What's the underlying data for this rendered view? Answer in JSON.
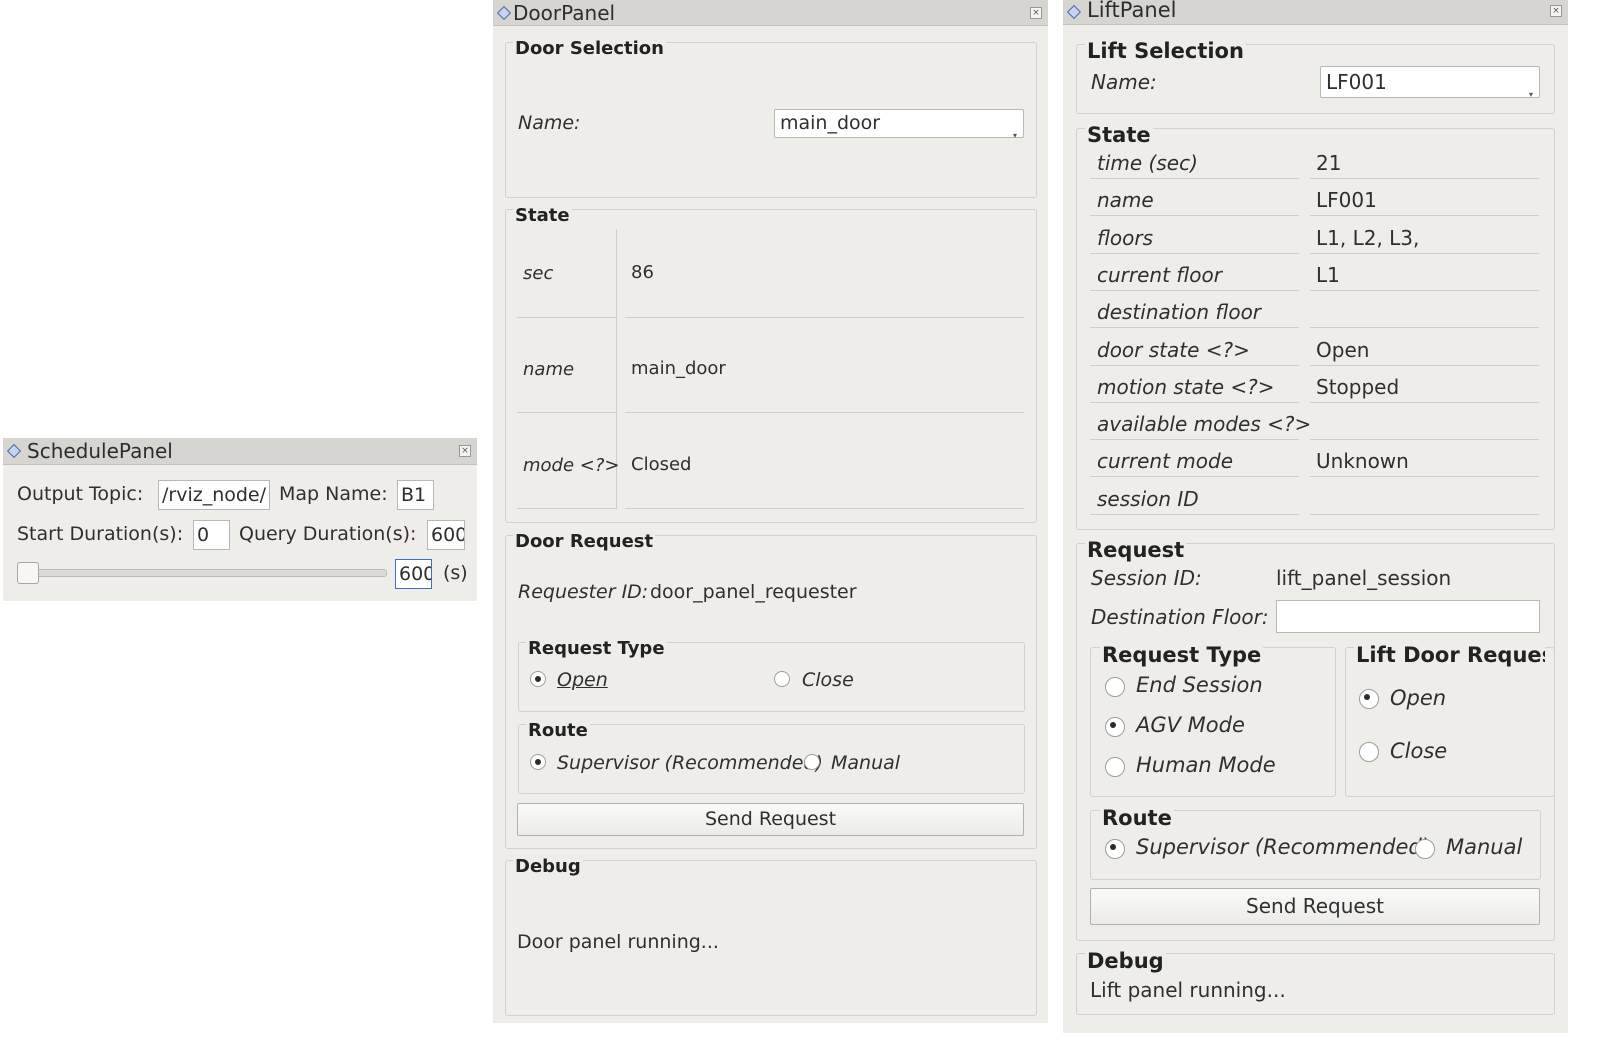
{
  "schedule": {
    "title": "SchedulePanel",
    "output_topic_label": "Output Topic:",
    "output_topic_value": "/rviz_node/",
    "map_name_label": "Map Name:",
    "map_name_value": "B1",
    "start_duration_label": "Start Duration(s):",
    "start_duration_value": "0",
    "query_duration_label": "Query Duration(s):",
    "query_duration_value": "600",
    "slider_value": "600",
    "slider_fraction": 0.0,
    "unit_label": "(s)"
  },
  "door": {
    "title": "DoorPanel",
    "selection_group": "Door Selection",
    "name_label": "Name:",
    "name_value": "main_door",
    "state_group": "State",
    "state_rows": [
      {
        "key": "sec",
        "value": "86"
      },
      {
        "key": "name",
        "value": "main_door"
      },
      {
        "key": "mode <?>",
        "value": "Closed"
      }
    ],
    "request_group": "Door Request",
    "requester_label": "Requester ID:",
    "requester_value": "door_panel_requester",
    "request_type_group": "Request Type",
    "request_type_options": [
      {
        "label": "Open",
        "selected": true
      },
      {
        "label": "Close",
        "selected": false
      }
    ],
    "route_group": "Route",
    "route_options": [
      {
        "label": "Supervisor (Recommended)",
        "selected": true
      },
      {
        "label": "Manual",
        "selected": false
      }
    ],
    "send_button": "Send Request",
    "debug_group": "Debug",
    "debug_text": "Door panel running..."
  },
  "lift": {
    "title": "LiftPanel",
    "selection_group": "Lift Selection",
    "name_label": "Name:",
    "name_value": "LF001",
    "state_group": "State",
    "state_rows": [
      {
        "key": "time (sec)",
        "value": "21"
      },
      {
        "key": "name",
        "value": "LF001"
      },
      {
        "key": "floors",
        "value": "L1, L2, L3,"
      },
      {
        "key": "current floor",
        "value": "L1"
      },
      {
        "key": "destination floor",
        "value": ""
      },
      {
        "key": "door state <?>",
        "value": "Open"
      },
      {
        "key": "motion state <?>",
        "value": "Stopped"
      },
      {
        "key": "available modes <?>",
        "value": ""
      },
      {
        "key": "current mode",
        "value": "Unknown"
      },
      {
        "key": "session ID",
        "value": ""
      }
    ],
    "request_group": "Request",
    "session_label": "Session ID:",
    "session_value": "lift_panel_session",
    "dest_label": "Destination Floor:",
    "dest_value": "",
    "request_type_group": "Request Type",
    "request_type_options": [
      {
        "label": "End Session",
        "selected": false
      },
      {
        "label": "AGV Mode",
        "selected": true
      },
      {
        "label": "Human Mode",
        "selected": false
      }
    ],
    "door_request_group": "Lift Door Request",
    "door_request_options": [
      {
        "label": "Open",
        "selected": true
      },
      {
        "label": "Close",
        "selected": false
      }
    ],
    "route_group": "Route",
    "route_options": [
      {
        "label": "Supervisor (Recommended)",
        "selected": true
      },
      {
        "label": "Manual",
        "selected": false
      }
    ],
    "send_button": "Send Request",
    "debug_group": "Debug",
    "debug_text": "Lift panel running..."
  }
}
